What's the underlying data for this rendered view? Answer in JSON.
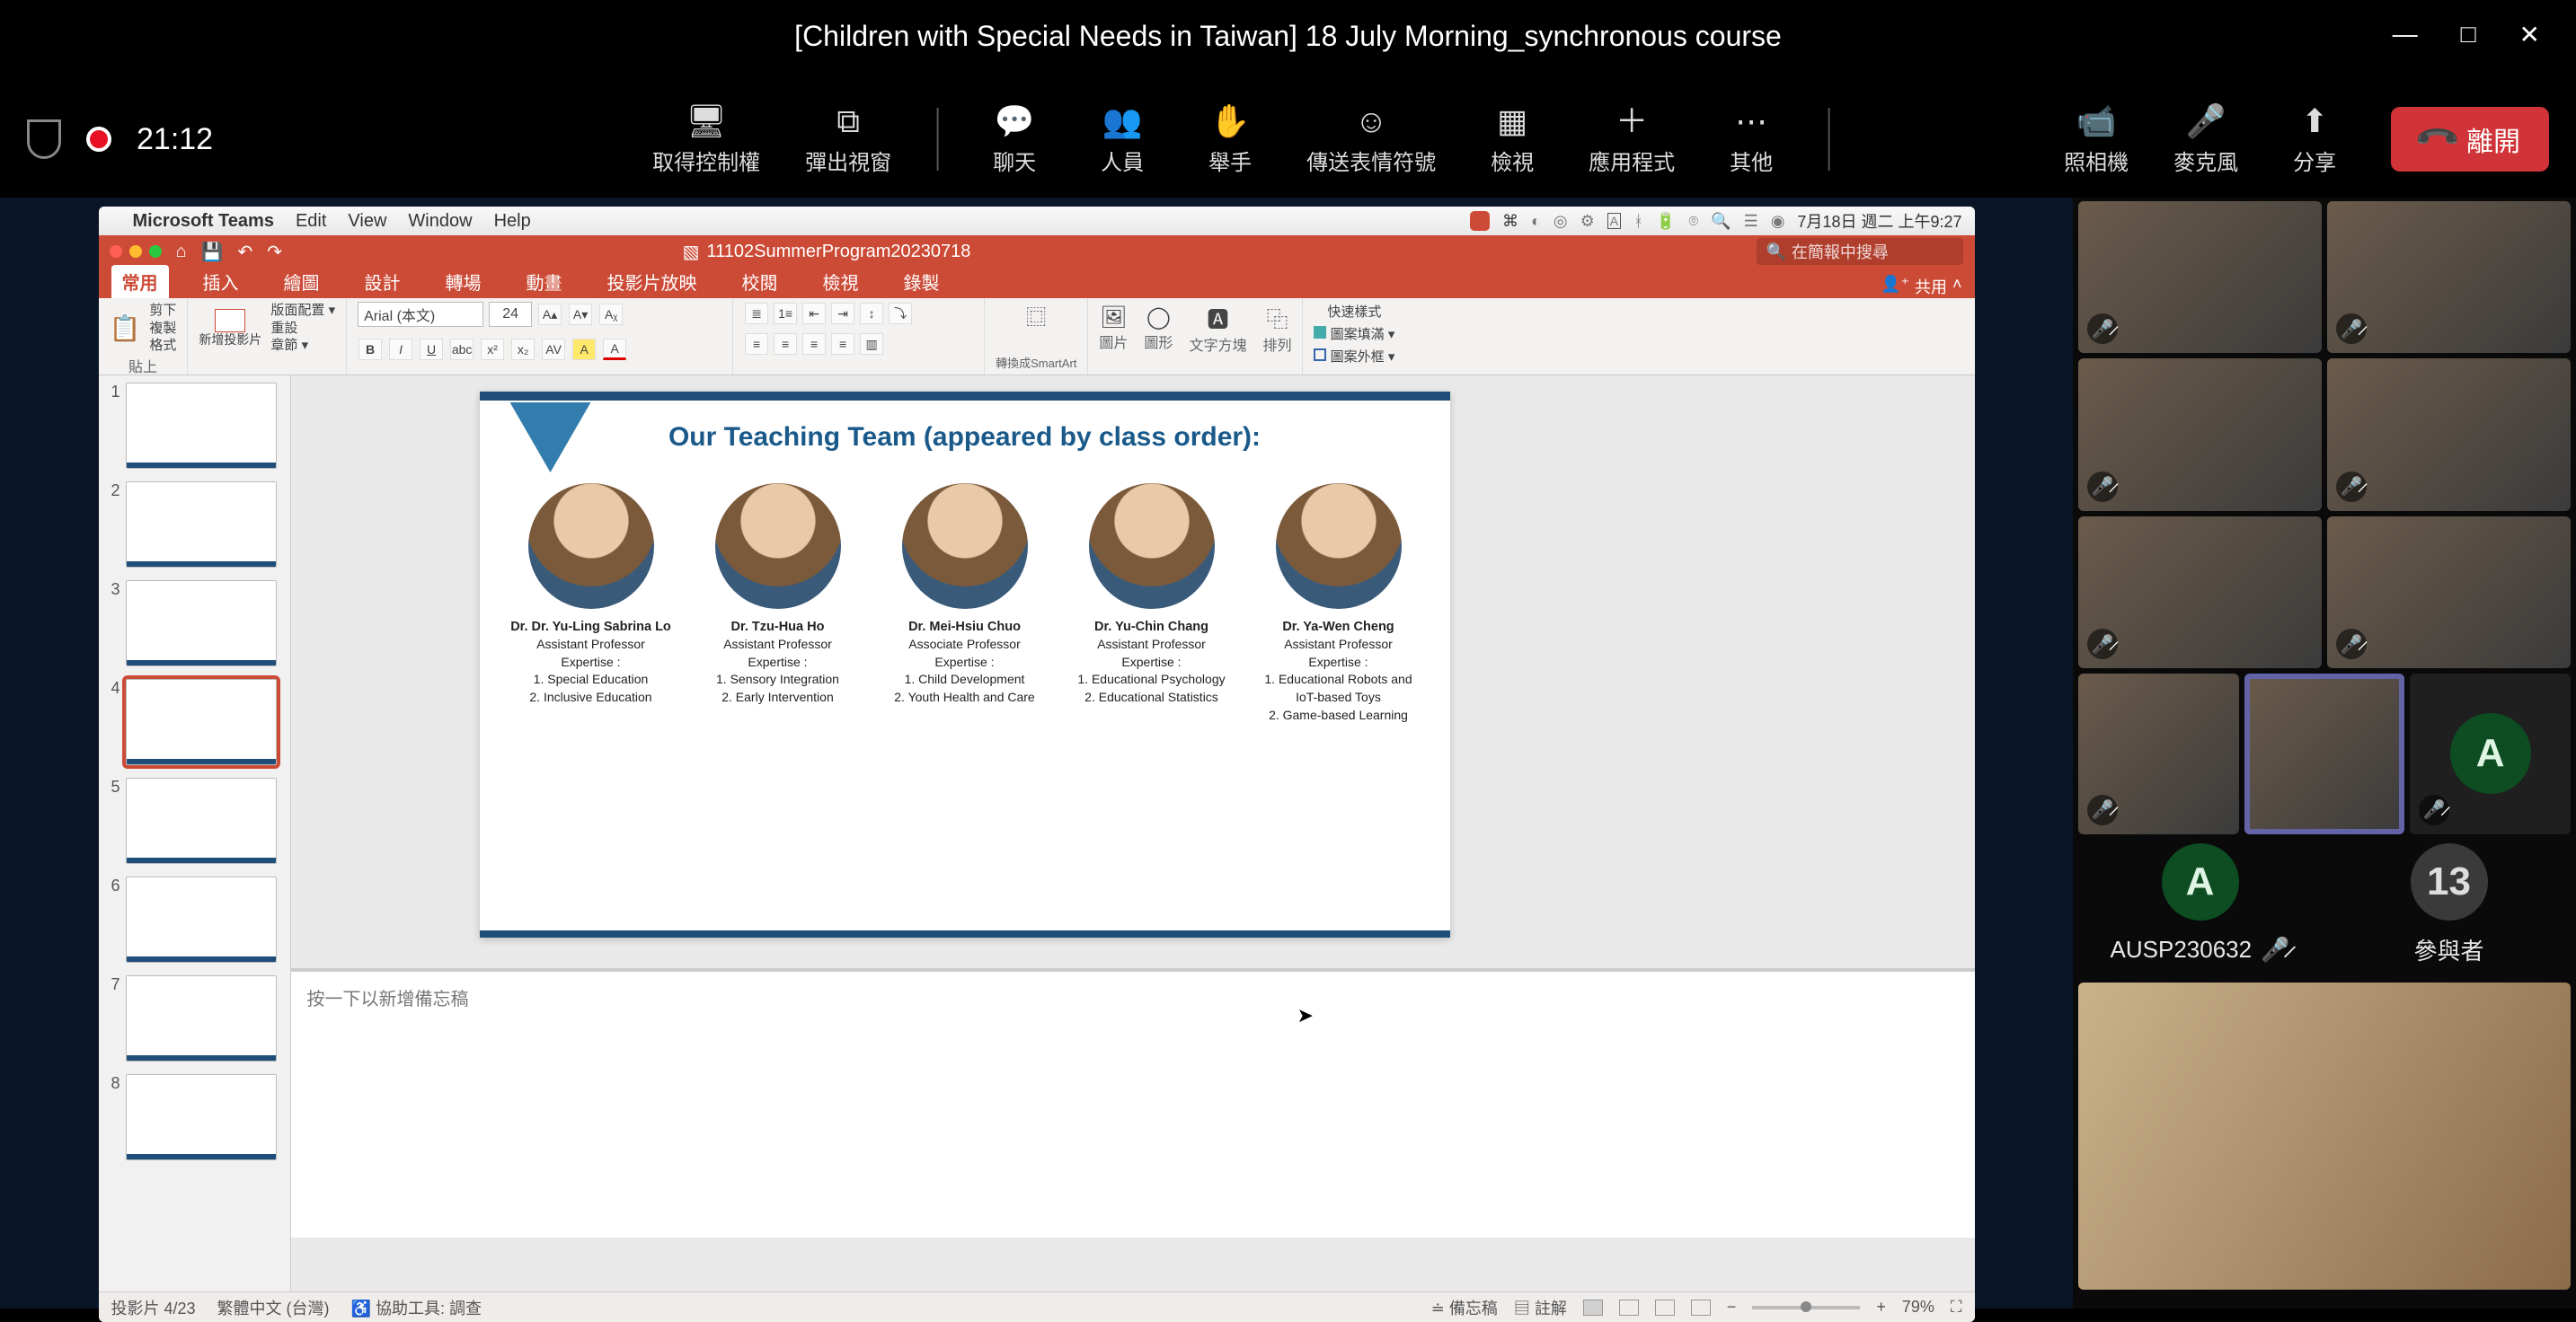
{
  "titlebar": {
    "title": "[Children with Special Needs in Taiwan] 18 July Morning_synchronous course"
  },
  "timer": "21:12",
  "toolbar": {
    "get_control": "取得控制權",
    "popout": "彈出視窗",
    "chat": "聊天",
    "people": "人員",
    "raise_hand": "舉手",
    "reactions": "傳送表情符號",
    "view": "檢視",
    "apps": "應用程式",
    "more": "其他",
    "camera": "照相機",
    "mic": "麥克風",
    "share": "分享",
    "leave": "離開"
  },
  "mac_menubar": {
    "app": "Microsoft Teams",
    "items": [
      "Edit",
      "View",
      "Window",
      "Help"
    ],
    "clock": "7月18日 週二 上午9:27"
  },
  "ppt": {
    "doc_name": "11102SummerProgram20230718",
    "search_placeholder": "在簡報中搜尋",
    "share_label": "共用",
    "tabs": [
      "常用",
      "插入",
      "繪圖",
      "設計",
      "轉場",
      "動畫",
      "投影片放映",
      "校閱",
      "檢視",
      "錄製"
    ],
    "active_tab": 0,
    "ribbon": {
      "paste": "貼上",
      "cut": "剪下",
      "copy": "複製",
      "format": "格式",
      "new_slide": "新增投影片",
      "section": "章節",
      "layout": "版面配置",
      "reset": "重設",
      "font_name": "Arial (本文)",
      "font_size": "24",
      "smartart": "轉換成SmartArt",
      "picture": "圖片",
      "shapes": "圖形",
      "textbox": "文字方塊",
      "arrange": "排列",
      "quick_styles": "快速樣式",
      "shape_fill": "圖案填滿",
      "shape_outline": "圖案外框"
    },
    "notes_placeholder": "按一下以新增備忘稿",
    "status": {
      "slide_counter": "投影片 4/23",
      "language": "繁體中文 (台灣)",
      "accessibility": "協助工具: 調查",
      "notes_btn": "備忘稿",
      "comments_btn": "註解",
      "zoom": "79%"
    },
    "slides_count": 8,
    "selected_slide": 4
  },
  "slide_content": {
    "heading": "Our Teaching Team (appeared by class order):",
    "members": [
      {
        "name": "Dr. Dr. Yu-Ling Sabrina Lo",
        "title": "Assistant Professor",
        "exp_label": "Expertise :",
        "lines": [
          "1. Special Education",
          "2. Inclusive Education"
        ]
      },
      {
        "name": "Dr. Tzu-Hua Ho",
        "title": "Assistant Professor",
        "exp_label": "Expertise :",
        "lines": [
          "1. Sensory Integration",
          "2. Early Intervention"
        ]
      },
      {
        "name": "Dr. Mei-Hsiu Chuo",
        "title": "Associate Professor",
        "exp_label": "Expertise :",
        "lines": [
          "1. Child Development",
          "2. Youth Health and Care"
        ]
      },
      {
        "name": "Dr. Yu-Chin Chang",
        "title": "Assistant Professor",
        "exp_label": "Expertise :",
        "lines": [
          "1. Educational Psychology",
          "2. Educational Statistics"
        ]
      },
      {
        "name": "Dr. Ya-Wen Cheng",
        "title": "Assistant Professor",
        "exp_label": "Expertise :",
        "lines": [
          "1. Educational Robots and IoT-based Toys",
          "2. Game-based Learning"
        ]
      }
    ]
  },
  "participants": {
    "named_avatar": {
      "initial": "A",
      "name": "AUSP230632"
    },
    "more_count": "13",
    "more_label": "參與者",
    "avatar_letter": "A"
  }
}
